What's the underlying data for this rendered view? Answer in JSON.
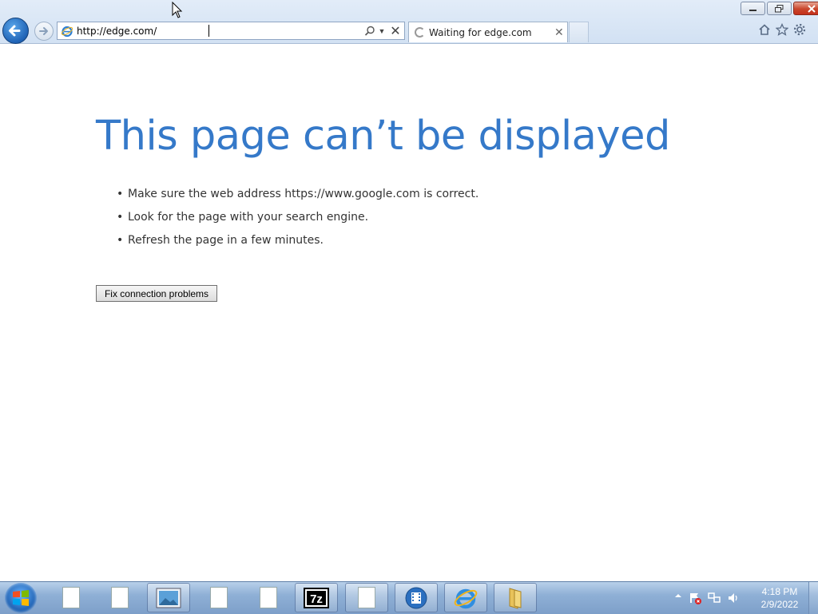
{
  "browser": {
    "address": {
      "url": "http://edge.com/"
    },
    "tab": {
      "title": "Waiting for edge.com"
    }
  },
  "page": {
    "heading": "This page can’t be displayed",
    "tips": [
      "Make sure the web address https://www.google.com is correct.",
      "Look for the page with your search engine.",
      "Refresh the page in a few minutes."
    ],
    "bullet": "•",
    "fix_button": "Fix connection problems"
  },
  "taskbar": {
    "items": [
      "document-icon",
      "document-icon",
      "photo-viewer-icon",
      "document-icon",
      "document-icon",
      "7zip-icon",
      "document-icon",
      "media-player-icon",
      "internet-explorer-icon",
      "folder-icon"
    ],
    "clock": {
      "time": "4:18 PM",
      "date": "2/9/2022"
    }
  },
  "colors": {
    "heading": "#3579c9",
    "close_button": "#c4301a"
  }
}
